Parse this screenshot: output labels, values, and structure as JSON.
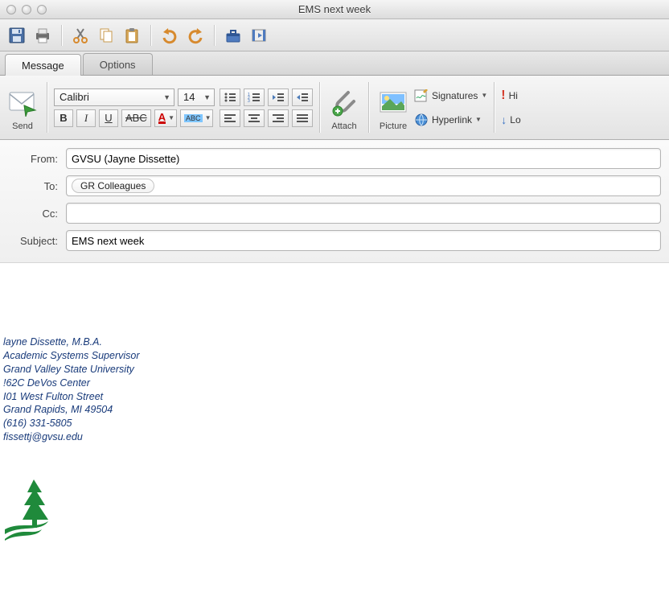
{
  "window": {
    "title": "EMS next week"
  },
  "tabs": {
    "message": "Message",
    "options": "Options"
  },
  "ribbon": {
    "send": "Send",
    "font_name": "Calibri",
    "font_size": "14",
    "attach": "Attach",
    "picture": "Picture",
    "signatures": "Signatures",
    "hyperlink": "Hyperlink",
    "hi": "Hi",
    "lo": "Lo"
  },
  "headers": {
    "from_label": "From:",
    "from_value": "GVSU (Jayne Dissette)",
    "to_label": "To:",
    "to_value": "GR Colleagues",
    "cc_label": "Cc:",
    "cc_value": "",
    "subject_label": "Subject:",
    "subject_value": "EMS next week"
  },
  "signature": {
    "line1": "layne Dissette, M.B.A.",
    "line2": "Academic Systems Supervisor",
    "line3": "Grand Valley State University",
    "line4": "!62C DeVos Center",
    "line5": "I01 West Fulton Street",
    "line6": "Grand Rapids, MI  49504",
    "line7": "(616) 331-5805",
    "line8": "fissettj@gvsu.edu"
  }
}
